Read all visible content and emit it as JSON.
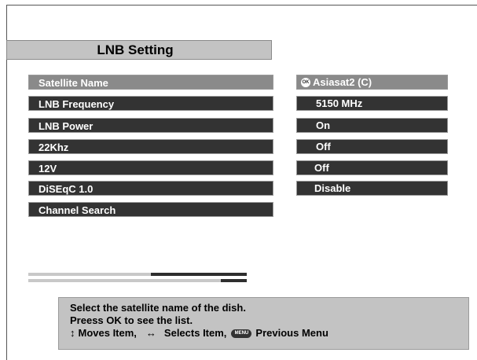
{
  "title": "LNB Setting",
  "menu": {
    "items": [
      {
        "label": "Satellite Name"
      },
      {
        "label": "LNB Frequency"
      },
      {
        "label": "LNB Power"
      },
      {
        "label": "22Khz"
      },
      {
        "label": "12V"
      },
      {
        "label": "DiSEqC 1.0"
      },
      {
        "label": "Channel Search"
      }
    ]
  },
  "values": {
    "satellite_name": "Asiasat2 (C)",
    "ok_badge": "OK",
    "lnb_frequency": "5150 MHz",
    "lnb_power": "On",
    "khz22": "Off",
    "v12": "Off",
    "diseqc": "Disable"
  },
  "progress": {
    "signal_strength": 0.44,
    "signal_quality": 0.12
  },
  "help": {
    "line1": "Select the satellite name of the dish.",
    "line2": "Preess OK to see the list.",
    "moves": "Moves Item,",
    "selects": "Selects Item,",
    "menu_badge": "MENU",
    "previous": "Previous Menu"
  },
  "colors": {
    "selected": "#8a8a8a",
    "item": "#333333",
    "panel": "#c3c3c3"
  },
  "icons": [
    "ok-button-icon",
    "up-down-arrow-icon",
    "left-right-arrow-icon",
    "menu-button-icon"
  ]
}
